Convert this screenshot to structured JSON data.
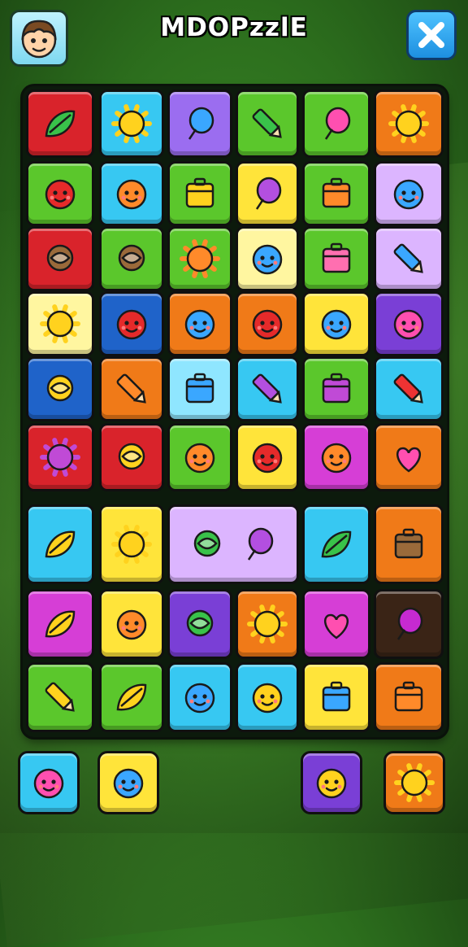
{
  "title": "MDOPzzlE",
  "colors": {
    "red": "#d9232b",
    "cyan": "#37c8f2",
    "purple": "#9b6df0",
    "green": "#5bc72c",
    "orange": "#f07a18",
    "yellow": "#ffe43a",
    "pale_yellow": "#fff6a0",
    "lavender": "#dcb5ff",
    "violet": "#7a3fd6",
    "blue": "#1f63c9",
    "light_cyan": "#8fe6ff",
    "magenta": "#d63ed6",
    "dark_brown": "#3a2416"
  },
  "header": {
    "avatar_icon": "boy-face-icon",
    "close_icon": "close-x-icon"
  },
  "tiles": [
    {
      "row": 0,
      "col": 0,
      "color": "red",
      "icons": [
        "green-blob-icon"
      ]
    },
    {
      "row": 0,
      "col": 1,
      "color": "cyan",
      "icons": [
        "sun-icon"
      ]
    },
    {
      "row": 0,
      "col": 2,
      "color": "purple",
      "icons": [
        "balloon-icon"
      ]
    },
    {
      "row": 0,
      "col": 3,
      "color": "green",
      "icons": [
        "pencil-icon"
      ]
    },
    {
      "row": 0,
      "col": 4,
      "color": "green",
      "icons": [
        "pink-balloon-icon"
      ]
    },
    {
      "row": 0,
      "col": 5,
      "color": "orange",
      "icons": [
        "sun-face-icon"
      ]
    },
    {
      "row": 1,
      "col": 0,
      "color": "green",
      "icons": [
        "red-fruit-face-icon"
      ]
    },
    {
      "row": 1,
      "col": 1,
      "color": "cyan",
      "icons": [
        "orange-face-icon"
      ]
    },
    {
      "row": 1,
      "col": 2,
      "color": "green",
      "icons": [
        "box-icon"
      ]
    },
    {
      "row": 1,
      "col": 3,
      "color": "yellow",
      "icons": [
        "purple-plum-icon"
      ]
    },
    {
      "row": 1,
      "col": 4,
      "color": "green",
      "icons": [
        "calculator-icon"
      ]
    },
    {
      "row": 1,
      "col": 5,
      "color": "lavender",
      "icons": [
        "blue-monster-icon"
      ]
    },
    {
      "row": 2,
      "col": 0,
      "color": "red",
      "icons": [
        "globe-icon"
      ]
    },
    {
      "row": 2,
      "col": 1,
      "color": "green",
      "icons": [
        "orb-icon"
      ]
    },
    {
      "row": 2,
      "col": 2,
      "color": "green",
      "icons": [
        "orange-star-icon"
      ]
    },
    {
      "row": 2,
      "col": 3,
      "color": "pale_yellow",
      "icons": [
        "blue-bird-face-icon"
      ]
    },
    {
      "row": 2,
      "col": 4,
      "color": "green",
      "icons": [
        "suitcase-icon"
      ]
    },
    {
      "row": 2,
      "col": 5,
      "color": "lavender",
      "icons": [
        "blue-crayon-icon"
      ]
    },
    {
      "row": 3,
      "col": 0,
      "color": "pale_yellow",
      "icons": [
        "smiling-sun-icon"
      ]
    },
    {
      "row": 3,
      "col": 1,
      "color": "blue",
      "icons": [
        "pineapple-face-icon"
      ]
    },
    {
      "row": 3,
      "col": 2,
      "color": "orange",
      "icons": [
        "blue-fish-icon"
      ]
    },
    {
      "row": 3,
      "col": 3,
      "color": "orange",
      "icons": [
        "apple-icon"
      ]
    },
    {
      "row": 3,
      "col": 4,
      "color": "yellow",
      "icons": [
        "blue-bird-icon"
      ]
    },
    {
      "row": 3,
      "col": 5,
      "color": "violet",
      "icons": [
        "pink-candy-icon"
      ]
    },
    {
      "row": 4,
      "col": 0,
      "color": "blue",
      "icons": [
        "lollipop-icon"
      ]
    },
    {
      "row": 4,
      "col": 1,
      "color": "orange",
      "icons": [
        "candy-roll-icon"
      ]
    },
    {
      "row": 4,
      "col": 2,
      "color": "light_cyan",
      "icons": [
        "crate-icon"
      ]
    },
    {
      "row": 4,
      "col": 3,
      "color": "cyan",
      "icons": [
        "purple-pencil-icon"
      ]
    },
    {
      "row": 4,
      "col": 4,
      "color": "green",
      "icons": [
        "shopping-bag-icon"
      ]
    },
    {
      "row": 4,
      "col": 5,
      "color": "cyan",
      "icons": [
        "battery-icon"
      ]
    },
    {
      "row": 5,
      "col": 0,
      "color": "red",
      "icons": [
        "flower-face-icon"
      ]
    },
    {
      "row": 5,
      "col": 1,
      "color": "red",
      "icons": [
        "swirl-icon"
      ]
    },
    {
      "row": 5,
      "col": 2,
      "color": "green",
      "icons": [
        "bear-face-icon"
      ]
    },
    {
      "row": 5,
      "col": 3,
      "color": "yellow",
      "icons": [
        "red-apple-icon"
      ]
    },
    {
      "row": 5,
      "col": 4,
      "color": "magenta",
      "icons": [
        "orange-fruit-icon"
      ]
    },
    {
      "row": 5,
      "col": 5,
      "color": "orange",
      "icons": [
        "heart-icon"
      ]
    },
    {
      "row": 6,
      "col": 0,
      "color": "cyan",
      "icons": [
        "yellow-leaf-icon"
      ]
    },
    {
      "row": 6,
      "col": 1,
      "color": "yellow",
      "icons": [
        "sun-critter-icon"
      ]
    },
    {
      "row": 6,
      "col": 2,
      "span": 2,
      "color": "lavender",
      "icons": [
        "green-ring-icon",
        "purple-balloon-icon"
      ]
    },
    {
      "row": 6,
      "col": 4,
      "color": "cyan",
      "icons": [
        "green-leaf-icon"
      ]
    },
    {
      "row": 6,
      "col": 5,
      "color": "orange",
      "icons": [
        "robot-icon"
      ]
    },
    {
      "row": 7,
      "col": 0,
      "color": "magenta",
      "icons": [
        "lemon-icon"
      ]
    },
    {
      "row": 7,
      "col": 1,
      "color": "yellow",
      "icons": [
        "orange-face-icon"
      ]
    },
    {
      "row": 7,
      "col": 2,
      "color": "violet",
      "icons": [
        "green-key-icon"
      ]
    },
    {
      "row": 7,
      "col": 3,
      "color": "orange",
      "icons": [
        "sunflower-face-icon"
      ]
    },
    {
      "row": 7,
      "col": 4,
      "color": "magenta",
      "icons": [
        "yellow-heart-icon"
      ]
    },
    {
      "row": 7,
      "col": 5,
      "color": "dark_brown",
      "icons": [
        "magenta-drop-icon"
      ]
    },
    {
      "row": 8,
      "col": 0,
      "color": "green",
      "icons": [
        "yellow-crayon-icon"
      ]
    },
    {
      "row": 8,
      "col": 1,
      "color": "green",
      "icons": [
        "lemon-face-icon"
      ]
    },
    {
      "row": 8,
      "col": 2,
      "color": "cyan",
      "icons": [
        "blue-ball-face-icon"
      ]
    },
    {
      "row": 8,
      "col": 3,
      "color": "cyan",
      "icons": [
        "yellow-snake-icon"
      ]
    },
    {
      "row": 8,
      "col": 4,
      "color": "yellow",
      "icons": [
        "notebook-icon"
      ]
    },
    {
      "row": 8,
      "col": 5,
      "color": "orange",
      "icons": [
        "robot-face-icon"
      ]
    }
  ],
  "bottom_bar": [
    {
      "slot": 0,
      "color": "cyan",
      "icon": "pink-cat-face-icon"
    },
    {
      "slot": 1,
      "color": "yellow",
      "icon": "blue-fish-face-icon"
    },
    {
      "slot": 4,
      "color": "violet",
      "icon": "yellow-arrow-icon"
    },
    {
      "slot": 5,
      "color": "orange",
      "icon": "sun-face-icon"
    }
  ]
}
